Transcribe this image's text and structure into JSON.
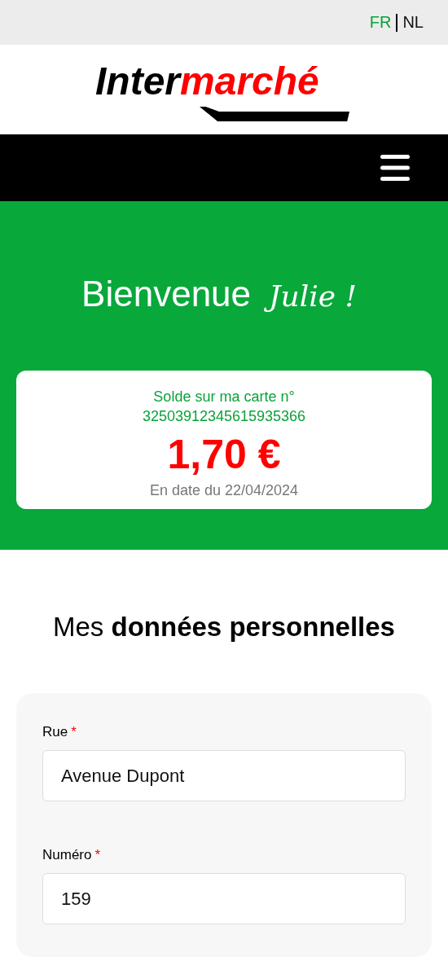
{
  "languages": [
    {
      "label": "FR",
      "selected": true
    },
    {
      "label": "NL",
      "selected": false
    }
  ],
  "logo": {
    "part_1": "Inter",
    "part_2": "marché"
  },
  "welcome": {
    "greeting": "Bienvenue",
    "name": "Julie !"
  },
  "balance_card": {
    "title": "Solde sur ma carte n°",
    "card_number": "32503912345615935366",
    "amount": "1,70 €",
    "date": "En date du 22/04/2024"
  },
  "section_title": "Mes **données personnelles**",
  "form": {
    "fields": [
      {
        "label": "Rue",
        "required_mark": "*",
        "value": "Avenue Dupont"
      },
      {
        "label": "Numéro",
        "required_mark": "*",
        "value": "159"
      }
    ]
  }
}
